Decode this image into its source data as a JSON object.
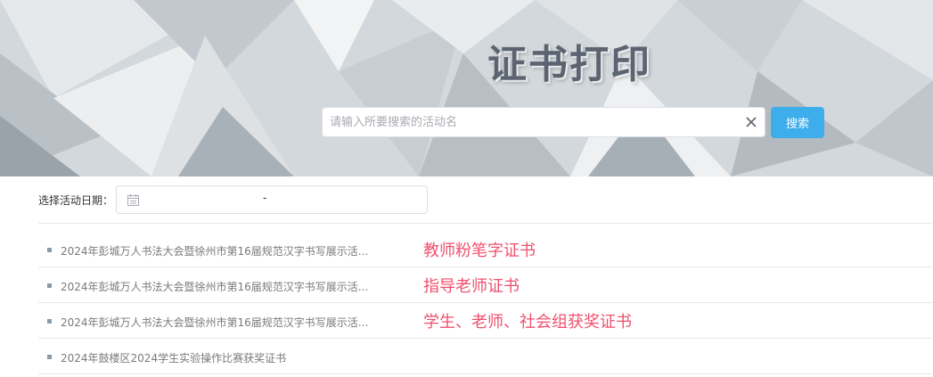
{
  "header": {
    "title": "证书打印",
    "search_placeholder": "请输入所要搜索的活动名",
    "search_value": "",
    "search_button_label": "搜索"
  },
  "filter": {
    "date_label": "选择活动日期：",
    "date_separator": "-"
  },
  "items": [
    {
      "text": "2024年彭城万人书法大会暨徐州市第16届规范汉字书写展示活...",
      "annotation": "教师粉笔字证书"
    },
    {
      "text": "2024年彭城万人书法大会暨徐州市第16届规范汉字书写展示活...",
      "annotation": "指导老师证书"
    },
    {
      "text": "2024年彭城万人书法大会暨徐州市第16届规范汉字书写展示活...",
      "annotation": "学生、老师、社会组获奖证书"
    },
    {
      "text": "2024年鼓楼区2024学生实验操作比赛获奖证书",
      "annotation": ""
    }
  ],
  "colors": {
    "accent": "#3dadeb",
    "annotation": "#f0506e"
  }
}
